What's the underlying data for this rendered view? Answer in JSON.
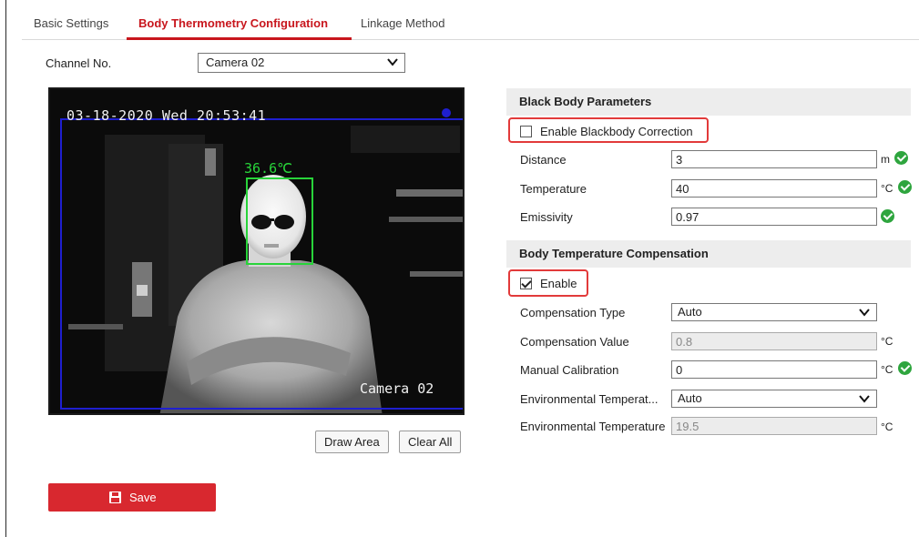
{
  "tabs": [
    {
      "label": "Basic Settings"
    },
    {
      "label": "Body Thermometry Configuration"
    },
    {
      "label": "Linkage Method"
    }
  ],
  "channel": {
    "label": "Channel No.",
    "value": "Camera 02"
  },
  "video": {
    "timestamp": "03-18-2020 Wed 20:53:41",
    "camera_name": "Camera 02",
    "detected_temp": "36.6℃"
  },
  "buttons": {
    "draw_area": "Draw Area",
    "clear_all": "Clear All",
    "save": "Save"
  },
  "blackbody": {
    "header": "Black Body Parameters",
    "enable_label": "Enable Blackbody Correction",
    "enable_checked": false,
    "distance_label": "Distance",
    "distance_value": "3",
    "distance_unit": "m",
    "temperature_label": "Temperature",
    "temperature_value": "40",
    "temperature_unit": "°C",
    "emissivity_label": "Emissivity",
    "emissivity_value": "0.97"
  },
  "compensation": {
    "header": "Body Temperature Compensation",
    "enable_label": "Enable",
    "enable_checked": true,
    "type_label": "Compensation Type",
    "type_value": "Auto",
    "value_label": "Compensation Value",
    "value_value": "0.8",
    "value_unit": "°C",
    "manual_label": "Manual Calibration",
    "manual_value": "0",
    "manual_unit": "°C",
    "env_type_label": "Environmental Temperat...",
    "env_type_value": "Auto",
    "env_temp_label": "Environmental Temperature",
    "env_temp_value": "19.5",
    "env_temp_unit": "°C"
  },
  "colors": {
    "accent": "#c8161d",
    "save_bg": "#d8282f",
    "highlight": "#e23a3a",
    "ok": "#2ea53e",
    "roi": "#1f1fd0",
    "face_box": "#28d43a"
  }
}
